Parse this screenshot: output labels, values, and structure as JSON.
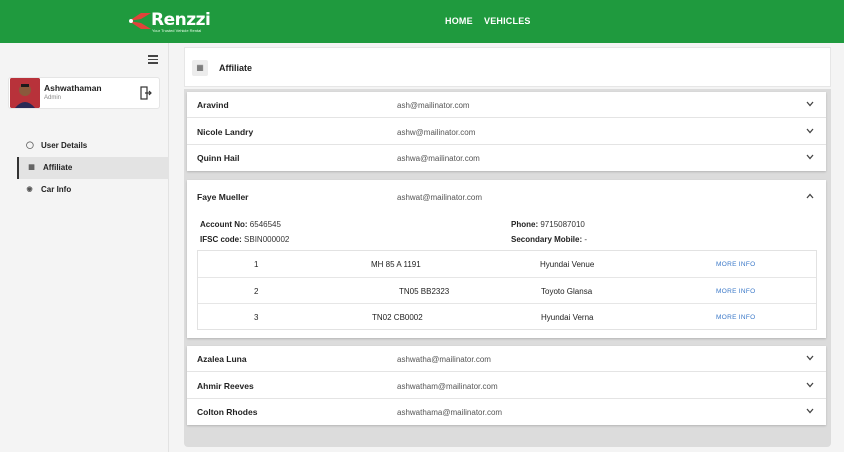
{
  "app": {
    "logo_text": "Renzzi",
    "logo_tagline": "Your Trusted Vehicle Rental"
  },
  "nav": {
    "home": "HOME",
    "vehicles": "VEHICLES"
  },
  "profile": {
    "name": "Ashwathaman",
    "role": "Admin"
  },
  "sidebar": {
    "items": [
      {
        "label": "User Details",
        "icon": "user-icon",
        "active": false
      },
      {
        "label": "Affiliate",
        "icon": "calculator-icon",
        "active": true
      },
      {
        "label": "Car Info",
        "icon": "car-icon",
        "active": false
      }
    ]
  },
  "page": {
    "title": "Affiliate"
  },
  "affiliates_top": [
    {
      "name": "Aravind",
      "email": "ash@mailinator.com"
    },
    {
      "name": "Nicole Landry",
      "email": "ashw@mailinator.com"
    },
    {
      "name": "Quinn Hail",
      "email": "ashwa@mailinator.com"
    }
  ],
  "expanded": {
    "name": "Faye Mueller",
    "email": "ashwat@mailinator.com",
    "account_no_label": "Account No:",
    "account_no": "6546545",
    "ifsc_label": "IFSC code:",
    "ifsc": "SBIN000002",
    "phone_label": "Phone:",
    "phone": "9715087010",
    "secondary_label": "Secondary Mobile:",
    "secondary": "-",
    "vehicles": [
      {
        "index": "1",
        "plate": "MH 85 A 1191",
        "model": "Hyundai Venue",
        "action": "MORE INFO"
      },
      {
        "index": "2",
        "plate": "TN05 BB2323",
        "model": "Toyoto Glansa",
        "action": "MORE INFO"
      },
      {
        "index": "3",
        "plate": "TN02 CB0002",
        "model": "Hyundai Verna",
        "action": "MORE INFO"
      }
    ]
  },
  "affiliates_bottom": [
    {
      "name": "Azalea Luna",
      "email": "ashwatha@mailinator.com"
    },
    {
      "name": "Ahmir Reeves",
      "email": "ashwatham@mailinator.com"
    },
    {
      "name": "Colton Rhodes",
      "email": "ashwathama@mailinator.com"
    }
  ],
  "colors": {
    "brand_green": "#1f9a3e",
    "logo_accent": "#e0433a",
    "link_blue": "#3a78c8"
  }
}
